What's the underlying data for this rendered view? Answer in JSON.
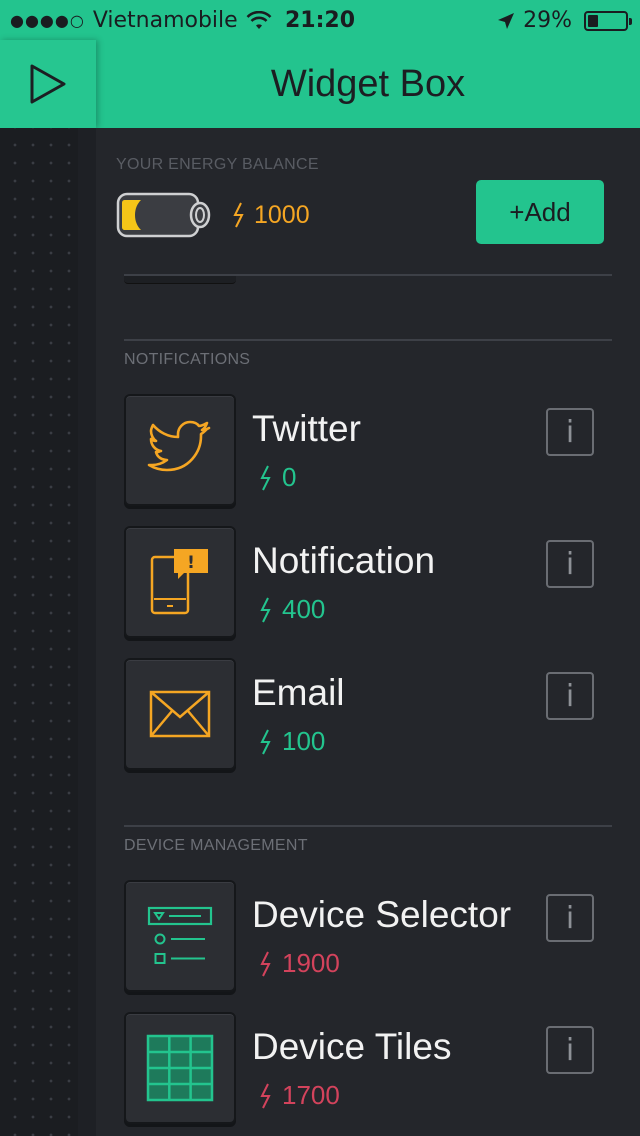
{
  "status_bar": {
    "signal_dots": "●●●●○",
    "carrier": "Vietnamobile",
    "time": "21:20",
    "battery_percent": "29%",
    "battery_level": 0.29
  },
  "header": {
    "title": "Widget Box"
  },
  "energy": {
    "label": "YOUR ENERGY BALANCE",
    "value": "1000",
    "add_label": "+Add"
  },
  "sections": {
    "notifications": {
      "title": "NOTIFICATIONS",
      "items": [
        {
          "name": "Twitter",
          "cost": "0",
          "icon": "twitter-bird-icon"
        },
        {
          "name": "Notification",
          "cost": "400",
          "icon": "phone-notification-icon"
        },
        {
          "name": "Email",
          "cost": "100",
          "icon": "envelope-icon"
        }
      ]
    },
    "device_management": {
      "title": "DEVICE MANAGEMENT",
      "items": [
        {
          "name": "Device Selector",
          "cost": "1900",
          "icon": "device-selector-icon"
        },
        {
          "name": "Device Tiles",
          "cost": "1700",
          "icon": "device-tiles-icon"
        }
      ]
    }
  },
  "info_label": "i",
  "colors": {
    "accent": "#23c48e",
    "energy": "#f5a623",
    "cost_affordable": "#23c48e",
    "cost_unaffordable": "#d3435c",
    "background": "#24262b"
  }
}
